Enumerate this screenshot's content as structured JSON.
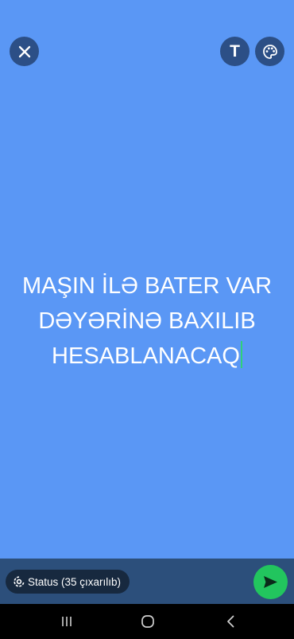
{
  "editor": {
    "status_lines": [
      "MAŞIN İLƏ BATER VAR",
      "DƏYƏRİNƏ BAXILIB",
      "HESABLANACAQ"
    ],
    "background_color": "#5a97f5",
    "text_color": "#ffffff",
    "caret_color": "#2fd07a"
  },
  "toolbar": {
    "close_icon": "close-icon",
    "text_tool_label": "T",
    "palette_icon": "palette-icon"
  },
  "bottom": {
    "audience_label": "Status (35 çıxarılıb)",
    "audience_icon": "status-ring-icon",
    "send_icon": "send-icon",
    "send_color": "#22c55e"
  },
  "navbar": {
    "recents_icon": "recents-icon",
    "home_icon": "home-icon",
    "back_icon": "back-icon"
  }
}
